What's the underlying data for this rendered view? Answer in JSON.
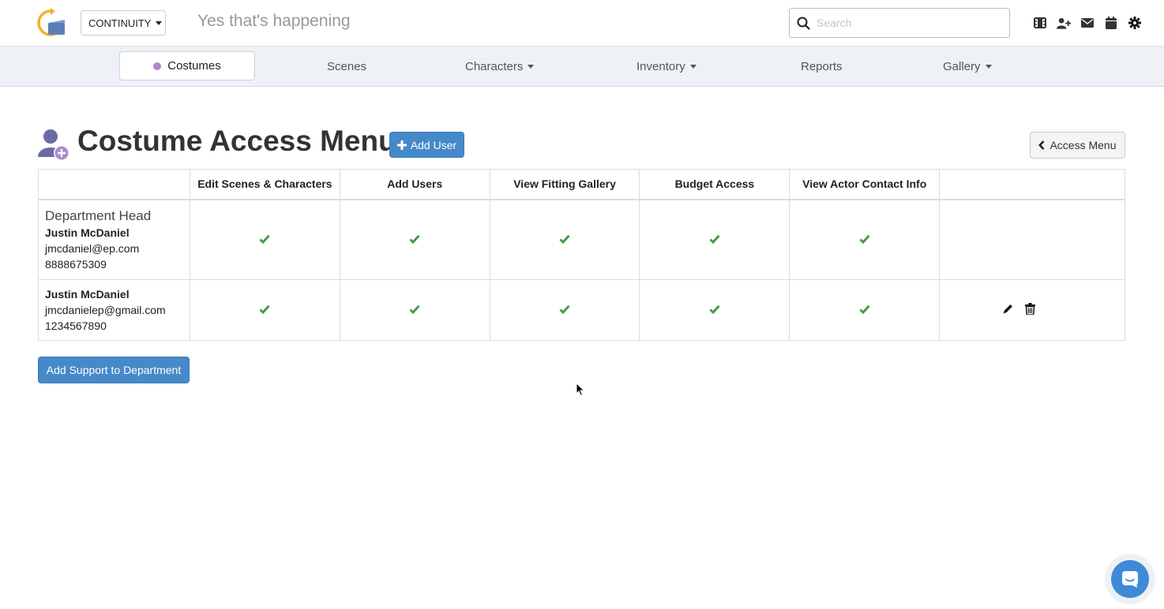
{
  "header": {
    "project_selector": "CONTINUITY",
    "tagline": "Yes that's happening",
    "search_placeholder": "Search",
    "icons": [
      "film-icon",
      "add-user-icon",
      "envelope-icon",
      "calendar-icon",
      "gear-icon"
    ]
  },
  "nav": {
    "items": [
      {
        "label": "Costumes",
        "active": true,
        "dot_color": "#a98bc9"
      },
      {
        "label": "Scenes"
      },
      {
        "label": "Characters",
        "dropdown": true
      },
      {
        "label": "Inventory",
        "dropdown": true
      },
      {
        "label": "Reports"
      },
      {
        "label": "Gallery",
        "dropdown": true
      }
    ]
  },
  "page": {
    "title": "Costume Access Menu",
    "add_user_label": "Add User",
    "access_menu_label": "Access Menu",
    "add_support_label": "Add Support to Department"
  },
  "table": {
    "columns": [
      "",
      "Edit Scenes & Characters",
      "Add Users",
      "View Fitting Gallery",
      "Budget Access",
      "View Actor Contact Info",
      ""
    ],
    "rows": [
      {
        "role": "Department Head",
        "name": "Justin McDaniel",
        "email": "jmcdaniel@ep.com",
        "phone": "8888675309",
        "permissions": [
          true,
          true,
          true,
          true,
          true
        ],
        "actions": []
      },
      {
        "role": "",
        "name": "Justin McDaniel",
        "email": "jmcdanielep@gmail.com",
        "phone": "1234567890",
        "permissions": [
          true,
          true,
          true,
          true,
          true
        ],
        "actions": [
          "edit-icon",
          "trash-icon"
        ]
      }
    ]
  },
  "colors": {
    "primary_button": "#4589c8",
    "check": "#4a9a4a",
    "nav_bg": "#eef2f6",
    "chat": "#3f8ad8"
  }
}
